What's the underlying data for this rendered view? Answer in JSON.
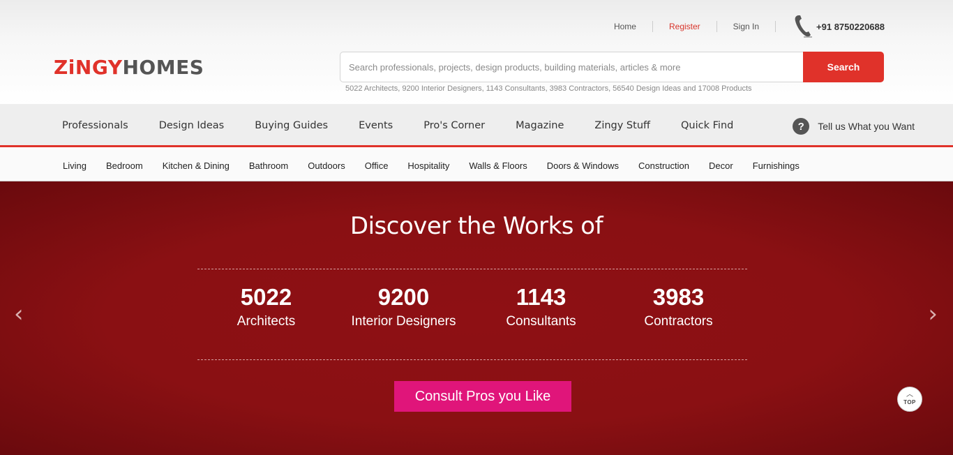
{
  "header": {
    "top_links": [
      {
        "label": "Home"
      },
      {
        "label": "Register"
      },
      {
        "label": "Sign In"
      }
    ],
    "phone": "+91 8750220688",
    "logo": {
      "part1": "ZiNGY",
      "part2": "HOMES"
    },
    "search": {
      "placeholder": "Search professionals, projects, design products, building materials, articles & more",
      "button_label": "Search",
      "stats_line": "5022 Architects, 9200 Interior Designers, 1143 Consultants, 3983 Contractors, 56540 Design Ideas and 17008 Products"
    }
  },
  "main_nav": {
    "items": [
      "Professionals",
      "Design Ideas",
      "Buying Guides",
      "Events",
      "Pro's Corner",
      "Magazine",
      "Zingy Stuff",
      "Quick Find"
    ],
    "tell_us": "Tell us What you Want"
  },
  "sub_nav": {
    "items": [
      "Living",
      "Bedroom",
      "Kitchen & Dining",
      "Bathroom",
      "Outdoors",
      "Office",
      "Hospitality",
      "Walls & Floors",
      "Doors & Windows",
      "Construction",
      "Decor",
      "Furnishings"
    ]
  },
  "hero": {
    "title": "Discover the Works of",
    "stats": [
      {
        "number": "5022",
        "label": "Architects"
      },
      {
        "number": "9200",
        "label": "Interior Designers"
      },
      {
        "number": "1143",
        "label": "Consultants"
      },
      {
        "number": "3983",
        "label": "Contractors"
      }
    ],
    "cta": "Consult Pros you Like",
    "prev_arrow": "‹",
    "next_arrow": "›",
    "top_button": "TOP"
  },
  "colors": {
    "brand_red": "#e0322a",
    "hero_bg": "#8a1013",
    "cta_pink": "#e0157a"
  }
}
